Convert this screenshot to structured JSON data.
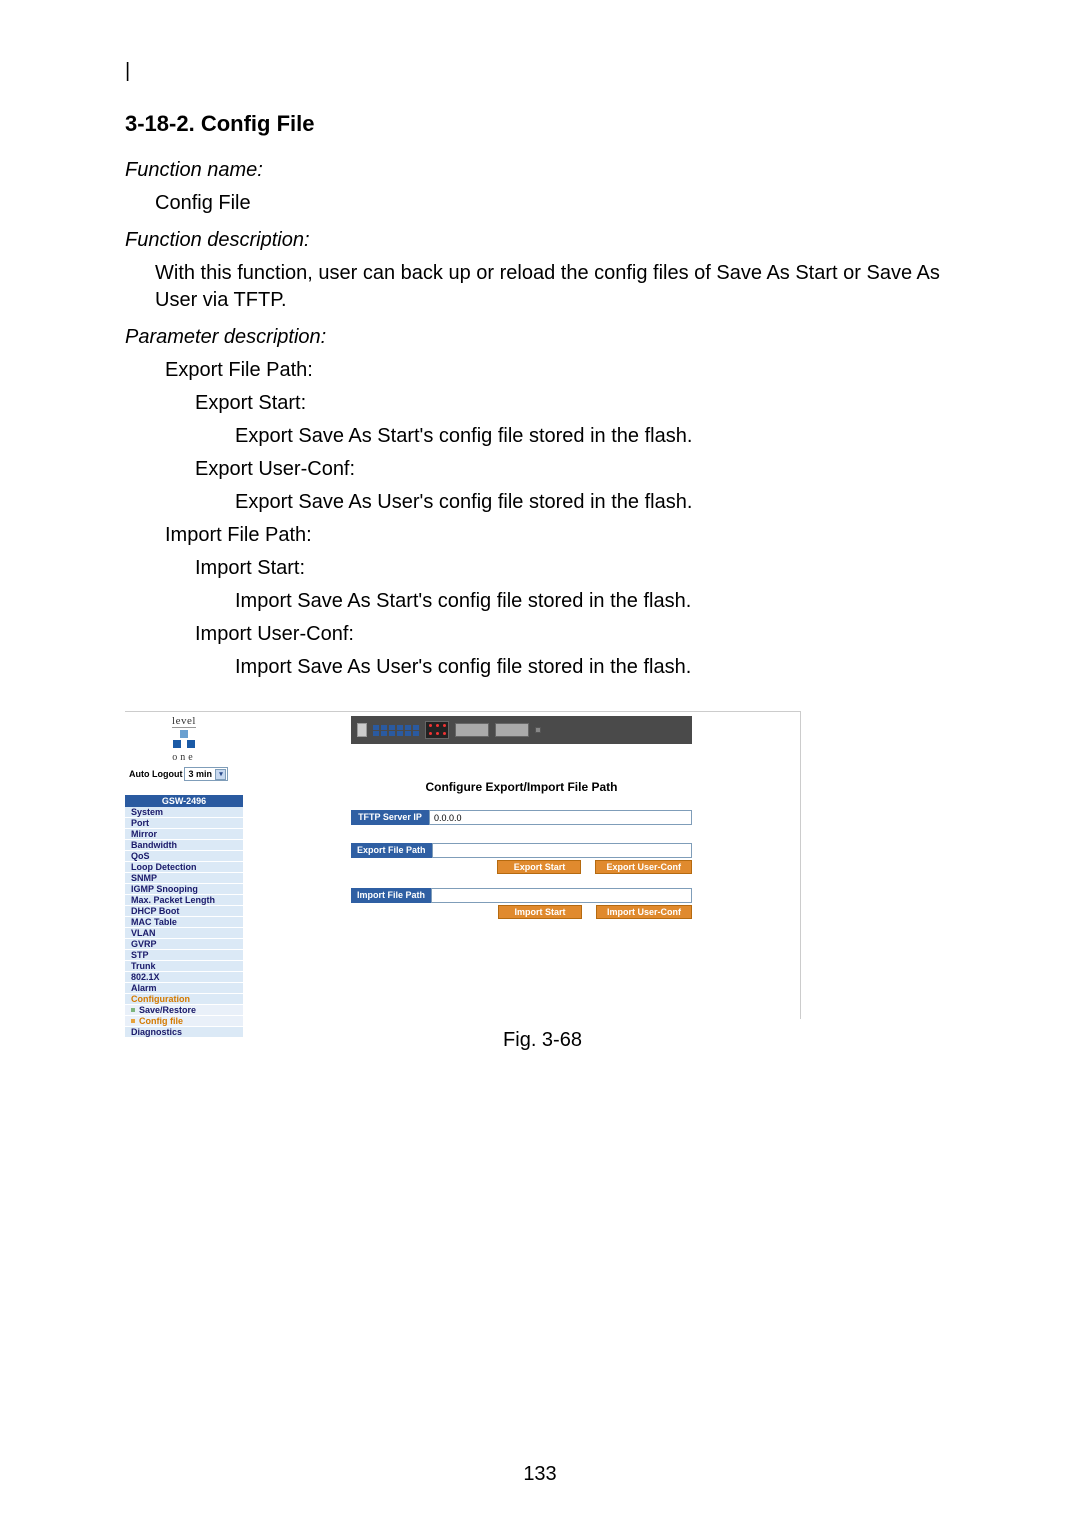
{
  "doc": {
    "bar_char": "|",
    "section_title": "3-18-2. Config File",
    "fn_name_label": "Function name:",
    "fn_name_value": "Config File",
    "fn_desc_label": "Function description:",
    "fn_desc_value": "With this function, user can back up or reload the config files of Save As Start or Save As User via TFTP.",
    "param_label": "Parameter description:",
    "p_export_path": "Export File Path:",
    "p_export_start_h": "Export Start:",
    "p_export_start_d": "Export Save As Start's config file stored in the flash.",
    "p_export_user_h": "Export User-Conf:",
    "p_export_user_d": "Export Save As User's config file stored in the flash.",
    "p_import_path": "Import File Path:",
    "p_import_start_h": "Import Start:",
    "p_import_start_d": "Import Save As Start's config file stored in the flash.",
    "p_import_user_h": "Import User-Conf:",
    "p_import_user_d": "Import Save As User's config file stored in the flash.",
    "fig_caption": "Fig. 3-68",
    "page_number": "133"
  },
  "app": {
    "logo_top": "level",
    "logo_bot": "one",
    "auto_logout_label": "Auto Logout",
    "auto_logout_value": "3 min",
    "device_model": "GSW-2496",
    "nav": [
      {
        "label": "System"
      },
      {
        "label": "Port"
      },
      {
        "label": "Mirror"
      },
      {
        "label": "Bandwidth"
      },
      {
        "label": "QoS"
      },
      {
        "label": "Loop Detection"
      },
      {
        "label": "SNMP"
      },
      {
        "label": "IGMP Snooping"
      },
      {
        "label": "Max. Packet Length"
      },
      {
        "label": "DHCP Boot"
      },
      {
        "label": "MAC Table"
      },
      {
        "label": "VLAN"
      },
      {
        "label": "GVRP"
      },
      {
        "label": "STP"
      },
      {
        "label": "Trunk"
      },
      {
        "label": "802.1X"
      },
      {
        "label": "Alarm"
      },
      {
        "label": "Configuration",
        "active_top": true
      },
      {
        "label": "Save/Restore",
        "sub": true
      },
      {
        "label": "Config file",
        "sub": true,
        "active_sub": true
      },
      {
        "label": "Diagnostics"
      }
    ],
    "content": {
      "title": "Configure Export/Import File Path",
      "tftp_label": "TFTP Server IP",
      "tftp_value": "0.0.0.0",
      "export_label": "Export File Path",
      "export_value": "",
      "export_start_btn": "Export Start",
      "export_user_btn": "Export User-Conf",
      "import_label": "Import File Path",
      "import_value": "",
      "import_start_btn": "Import Start",
      "import_user_btn": "Import User-Conf"
    }
  }
}
